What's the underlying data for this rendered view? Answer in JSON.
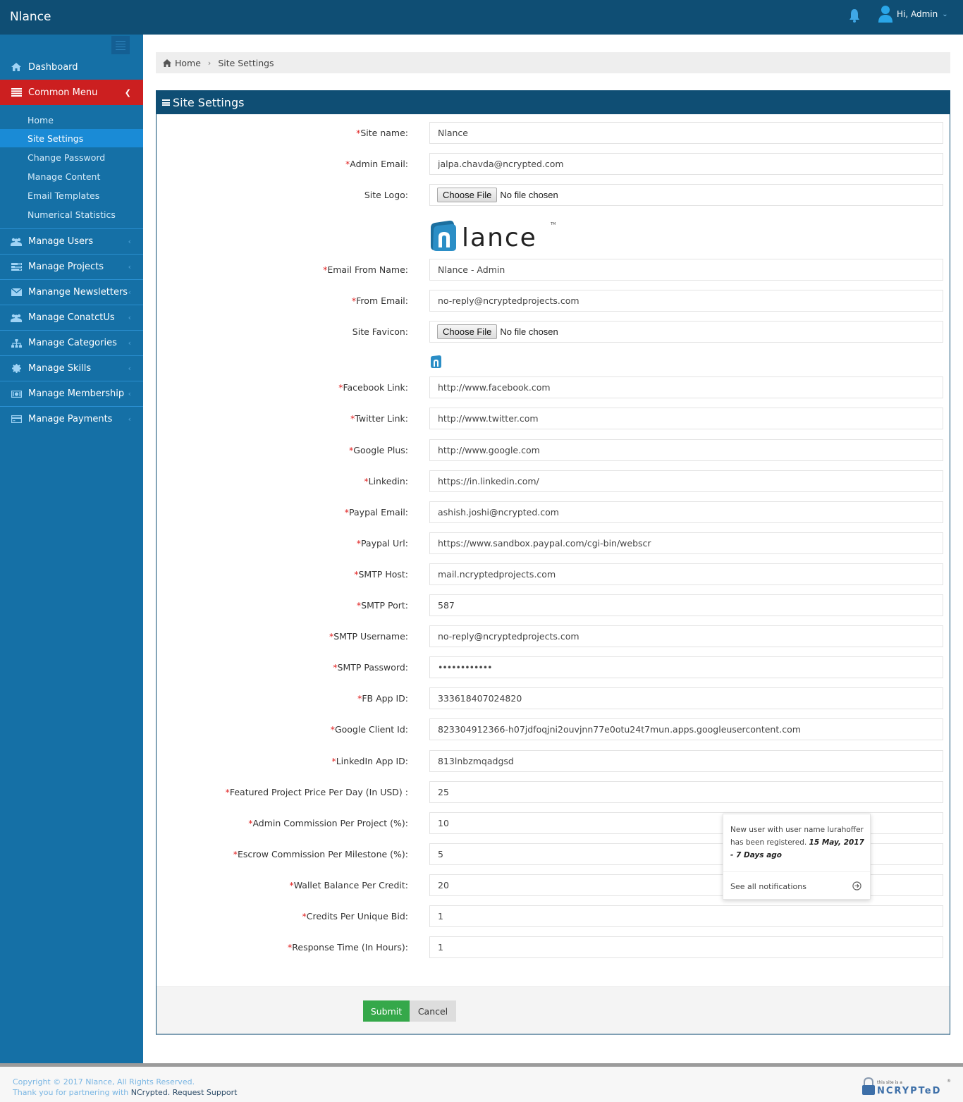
{
  "app": {
    "brand": "Nlance",
    "user_greeting": "Hi, Admin"
  },
  "sidebar": {
    "items": [
      {
        "label": "Dashboard",
        "icon": "home-icon"
      },
      {
        "label": "Common Menu",
        "icon": "list-icon",
        "active": true,
        "children": [
          {
            "label": "Home"
          },
          {
            "label": "Site Settings",
            "active": true
          },
          {
            "label": "Change Password"
          },
          {
            "label": "Manage Content"
          },
          {
            "label": "Email Templates"
          },
          {
            "label": "Numerical Statistics"
          }
        ]
      },
      {
        "label": "Manage Users",
        "icon": "users-icon"
      },
      {
        "label": "Manage Projects",
        "icon": "tasks-icon"
      },
      {
        "label": "Manange Newsletters",
        "icon": "envelope-icon"
      },
      {
        "label": "Manage ConatctUs",
        "icon": "users-icon"
      },
      {
        "label": "Manage Categories",
        "icon": "sitemap-icon"
      },
      {
        "label": "Manage Skills",
        "icon": "gear-icon"
      },
      {
        "label": "Manage Membership",
        "icon": "money-icon"
      },
      {
        "label": "Manage Payments",
        "icon": "credit-card-icon"
      }
    ]
  },
  "breadcrumb": {
    "home": "Home",
    "current": "Site Settings"
  },
  "panel": {
    "title": "Site Settings"
  },
  "form": {
    "required_mark": "*",
    "file_button": "Choose File",
    "file_none": "No file chosen",
    "fields": [
      {
        "label": "Site name:",
        "required": true,
        "value": "Nlance"
      },
      {
        "label": "Admin Email:",
        "required": true,
        "value": "jalpa.chavda@ncrypted.com"
      },
      {
        "label": "Site Logo:",
        "required": false,
        "type": "file"
      },
      {
        "label": "Email From Name:",
        "required": true,
        "value": "Nlance - Admin"
      },
      {
        "label": "From Email:",
        "required": true,
        "value": "no-reply@ncryptedprojects.com"
      },
      {
        "label": "Site Favicon:",
        "required": false,
        "type": "file"
      },
      {
        "label": "Facebook Link:",
        "required": true,
        "value": "http://www.facebook.com"
      },
      {
        "label": "Twitter Link:",
        "required": true,
        "value": "http://www.twitter.com"
      },
      {
        "label": "Google Plus:",
        "required": true,
        "value": "http://www.google.com"
      },
      {
        "label": "Linkedin:",
        "required": true,
        "value": "https://in.linkedin.com/"
      },
      {
        "label": "Paypal Email:",
        "required": true,
        "value": "ashish.joshi@ncrypted.com"
      },
      {
        "label": "Paypal Url:",
        "required": true,
        "value": "https://www.sandbox.paypal.com/cgi-bin/webscr"
      },
      {
        "label": "SMTP Host:",
        "required": true,
        "value": "mail.ncryptedprojects.com"
      },
      {
        "label": "SMTP Port:",
        "required": true,
        "value": "587"
      },
      {
        "label": "SMTP Username:",
        "required": true,
        "value": "no-reply@ncryptedprojects.com"
      },
      {
        "label": "SMTP Password:",
        "required": true,
        "value": "••••••••••••",
        "type": "password"
      },
      {
        "label": "FB App ID:",
        "required": true,
        "value": "333618407024820"
      },
      {
        "label": "Google Client Id:",
        "required": true,
        "value": "823304912366-h07jdfoqjni2ouvjnn77e0otu24t7mun.apps.googleusercontent.com"
      },
      {
        "label": "LinkedIn App ID:",
        "required": true,
        "value": "813lnbzmqadgsd"
      },
      {
        "label": "Featured Project Price Per Day (In USD) :",
        "required": true,
        "value": "25"
      },
      {
        "label": "Admin Commission Per Project (%):",
        "required": true,
        "value": "10"
      },
      {
        "label": "Escrow Commission Per Milestone (%):",
        "required": true,
        "value": "5"
      },
      {
        "label": "Wallet Balance Per Credit:",
        "required": true,
        "value": "20"
      },
      {
        "label": "Credits Per Unique Bid:",
        "required": true,
        "value": "1"
      },
      {
        "label": "Response Time (In Hours):",
        "required": true,
        "value": "1"
      }
    ],
    "submit": "Submit",
    "cancel": "Cancel"
  },
  "notification": {
    "message": "New user with user name lurahoffer has been registered.",
    "meta": "15 May, 2017 - 7 Days ago",
    "see_all": "See all notifications"
  },
  "footer": {
    "copyright": "Copyright © 2017 Nlance, All Rights Reserved.",
    "partner_prefix": "Thank you for partnering with ",
    "partner_name": "NCrypted.",
    "support": " Request Support",
    "badge_small": "this site is a",
    "badge_big": "NCRYPTeD"
  },
  "colors": {
    "header": "#0f4e74",
    "sidebar": "#1570a6",
    "active_menu": "#cc1f20",
    "active_submenu": "#1a8bd6",
    "submit": "#35a84a",
    "required": "#e02020"
  }
}
